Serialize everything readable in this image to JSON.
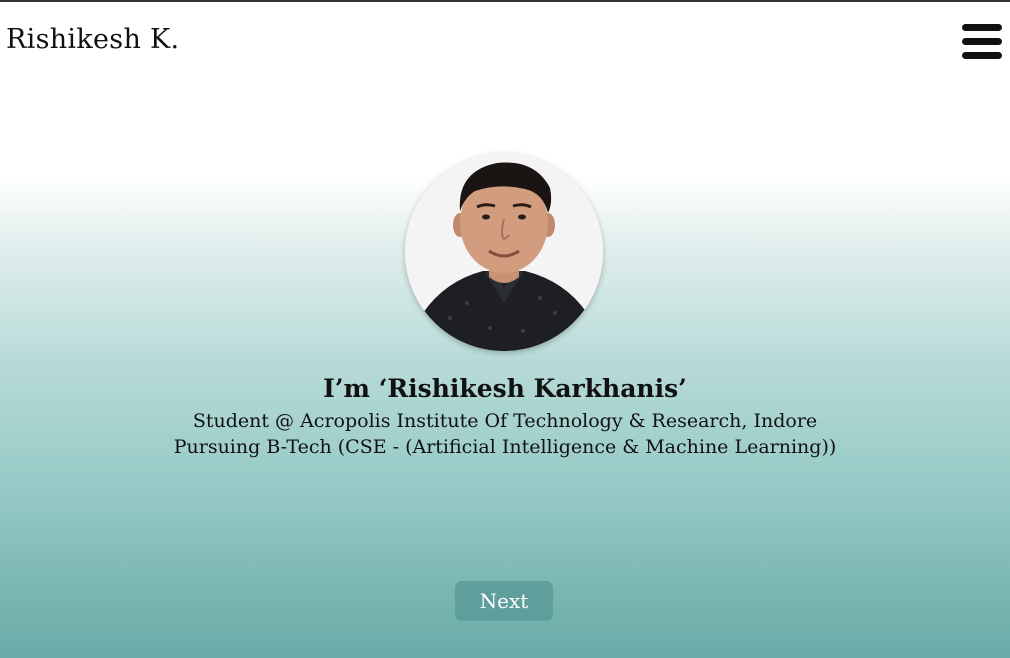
{
  "header": {
    "brand": "Rishikesh K.",
    "menu_icon": "hamburger-menu-icon"
  },
  "profile": {
    "photo": "profile-photo"
  },
  "intro": {
    "title": "I’m ‘Rishikesh Karkhanis’",
    "line1": "Student @ Acropolis Institute Of Technology & Research, Indore",
    "line2": "Pursuing B-Tech (CSE - (Artificial Intelligence & Machine Learning))"
  },
  "actions": {
    "next_label": "Next"
  },
  "colors": {
    "accent": "#5f9f9b",
    "gradient_bottom": "#6aaca8",
    "text": "#111111"
  }
}
